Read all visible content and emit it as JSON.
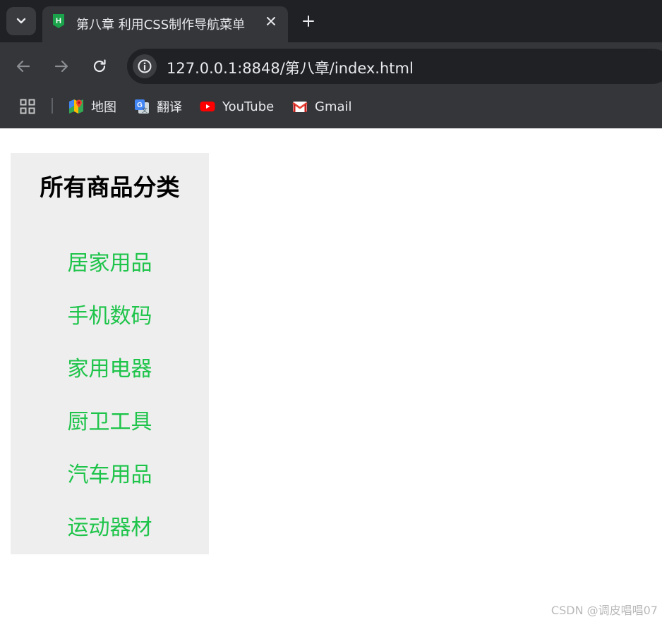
{
  "browser": {
    "tab": {
      "title": "第八章 利用CSS制作导航菜单",
      "favicon_icon": "hbuilder-h-icon",
      "favicon_letter": "H"
    },
    "address_bar": {
      "url": "127.0.0.1:8848/第八章/index.html"
    },
    "bookmarks": [
      {
        "label": "地图",
        "icon": "google-maps-icon"
      },
      {
        "label": "翻译",
        "icon": "google-translate-icon"
      },
      {
        "label": "YouTube",
        "icon": "youtube-icon"
      },
      {
        "label": "Gmail",
        "icon": "gmail-icon"
      }
    ]
  },
  "page": {
    "heading": "所有商品分类",
    "categories": [
      "居家用品",
      "手机数码",
      "家用电器",
      "厨卫工具",
      "汽车用品",
      "运动器材"
    ],
    "colors": {
      "panel_bg": "#eeeeee",
      "link": "#1ec44a",
      "heading": "#000000"
    }
  },
  "watermark": "CSDN @调皮唱唱07"
}
